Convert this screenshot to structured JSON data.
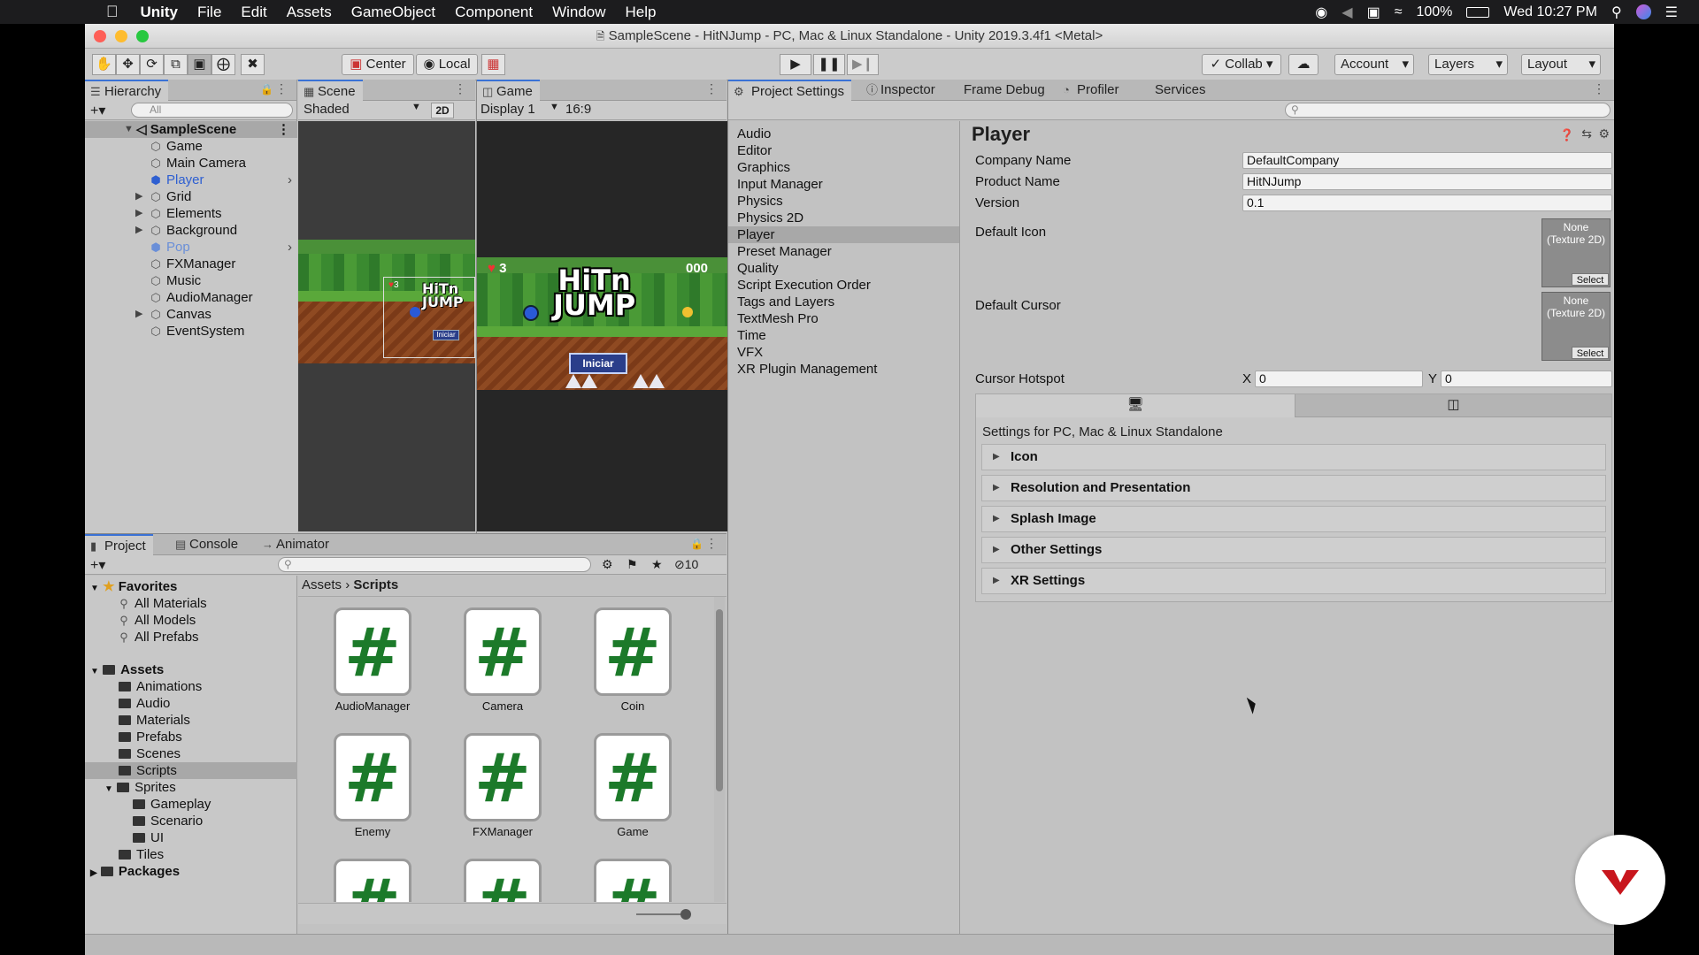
{
  "menubar": {
    "items": [
      "Unity",
      "File",
      "Edit",
      "Assets",
      "GameObject",
      "Component",
      "Window",
      "Help"
    ],
    "battery": "100%",
    "clock": "Wed 10:27 PM"
  },
  "window": {
    "title": "SampleScene - HitNJump - PC, Mac & Linux Standalone - Unity 2019.3.4f1 <Metal>"
  },
  "toolbar": {
    "pivot": "Center",
    "space": "Local",
    "collab": "Collab",
    "account": "Account",
    "layers": "Layers",
    "layout": "Layout"
  },
  "hierarchy": {
    "tab": "Hierarchy",
    "search_placeholder": "All",
    "scene": "SampleScene",
    "items": [
      "Game",
      "Main Camera",
      "Player",
      "Grid",
      "Elements",
      "Background",
      "Pop",
      "FXManager",
      "Music",
      "AudioManager",
      "Canvas",
      "EventSystem"
    ]
  },
  "scene_view": {
    "tab": "Scene",
    "shading": "Shaded",
    "mode2d": "2D"
  },
  "game_view": {
    "tab": "Game",
    "display": "Display 1",
    "aspect": "16:9",
    "lives": "3",
    "score": "000",
    "logo_line1": "HiTn",
    "logo_line2": "JUMP",
    "start_button": "Iniciar",
    "scene_lives": "3",
    "scene_logo_line1": "HiTn",
    "scene_logo_line2": "JUMP",
    "scene_start_button": "Iniciar"
  },
  "inspector_tabs": [
    "Project Settings",
    "Inspector",
    "Frame Debug",
    "Profiler",
    "Services"
  ],
  "project_settings": {
    "categories": [
      "Audio",
      "Editor",
      "Graphics",
      "Input Manager",
      "Physics",
      "Physics 2D",
      "Player",
      "Preset Manager",
      "Quality",
      "Script Execution Order",
      "Tags and Layers",
      "TextMesh Pro",
      "Time",
      "VFX",
      "XR Plugin Management"
    ],
    "selected": "Player",
    "title": "Player",
    "company_label": "Company Name",
    "company_value": "DefaultCompany",
    "product_label": "Product Name",
    "product_value": "HitNJump",
    "version_label": "Version",
    "version_value": "0.1",
    "default_icon_label": "Default Icon",
    "default_cursor_label": "Default Cursor",
    "texture_none_1": "None",
    "texture_type_1": "(Texture 2D)",
    "texture_none_2": "None",
    "texture_type_2": "(Texture 2D)",
    "select_label": "Select",
    "hotspot_label": "Cursor Hotspot",
    "hotspot_x_label": "X",
    "hotspot_x": "0",
    "hotspot_y_label": "Y",
    "hotspot_y": "0",
    "platform_text": "Settings for PC, Mac & Linux Standalone",
    "sections": [
      "Icon",
      "Resolution and Presentation",
      "Splash Image",
      "Other Settings",
      "XR Settings"
    ]
  },
  "project_panel": {
    "tabs": [
      "Project",
      "Console",
      "Animator"
    ],
    "hidden_count": "10",
    "favorites_label": "Favorites",
    "favorites": [
      "All Materials",
      "All Models",
      "All Prefabs"
    ],
    "assets_label": "Assets",
    "asset_folders": [
      "Animations",
      "Audio",
      "Materials",
      "Prefabs",
      "Scenes",
      "Scripts"
    ],
    "sprites_label": "Sprites",
    "sprite_folders": [
      "Gameplay",
      "Scenario",
      "UI"
    ],
    "tiles_label": "Tiles",
    "packages_label": "Packages",
    "breadcrumb_root": "Assets",
    "breadcrumb_current": "Scripts",
    "scripts": [
      "AudioManager",
      "Camera",
      "Coin",
      "Enemy",
      "FXManager",
      "Game"
    ],
    "script_glyph": "#"
  }
}
